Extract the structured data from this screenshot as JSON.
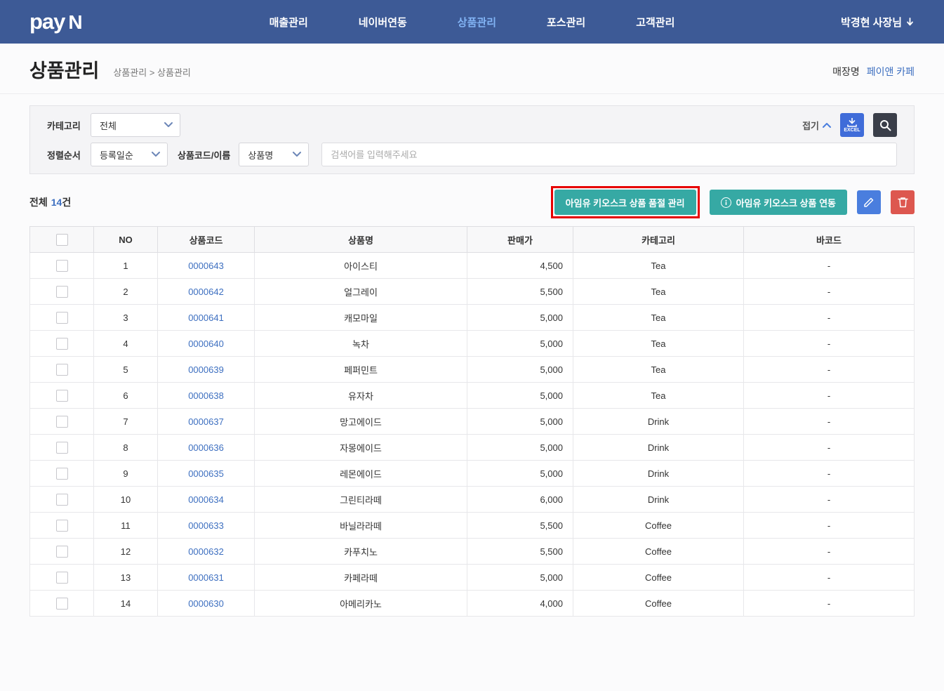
{
  "brand": {
    "logo_text_1": "pay",
    "logo_text_2": "N"
  },
  "nav": {
    "items": [
      {
        "label": "매출관리"
      },
      {
        "label": "네이버연동"
      },
      {
        "label": "상품관리"
      },
      {
        "label": "포스관리"
      },
      {
        "label": "고객관리"
      }
    ],
    "active_index": 2,
    "user": "박경현 사장님"
  },
  "page": {
    "title": "상품관리",
    "breadcrumb": "상품관리 > 상품관리",
    "store_label": "매장명",
    "store_name": "페이앤 카페"
  },
  "filters": {
    "category_label": "카테고리",
    "category_value": "전체",
    "sort_label": "정렬순서",
    "sort_value": "등록일순",
    "code_name_label": "상품코드/이름",
    "search_type_value": "상품명",
    "search_placeholder": "검색어를 입력해주세요",
    "collapse_label": "접기",
    "excel_label": "EXCEL"
  },
  "toolbar": {
    "total_label": "전체",
    "total_count": "14",
    "total_suffix": "건",
    "soldout_button_label": "아임유 키오스크 상품 품절 관리",
    "sync_button_label": "아임유 키오스크 상품 연동"
  },
  "table": {
    "headers": [
      "NO",
      "상품코드",
      "상품명",
      "판매가",
      "카테고리",
      "바코드"
    ],
    "rows": [
      {
        "no": "1",
        "code": "0000643",
        "name": "아이스티",
        "price": "4,500",
        "category": "Tea",
        "barcode": "-"
      },
      {
        "no": "2",
        "code": "0000642",
        "name": "얼그레이",
        "price": "5,500",
        "category": "Tea",
        "barcode": "-"
      },
      {
        "no": "3",
        "code": "0000641",
        "name": "캐모마일",
        "price": "5,000",
        "category": "Tea",
        "barcode": "-"
      },
      {
        "no": "4",
        "code": "0000640",
        "name": "녹차",
        "price": "5,000",
        "category": "Tea",
        "barcode": "-"
      },
      {
        "no": "5",
        "code": "0000639",
        "name": "페퍼민트",
        "price": "5,000",
        "category": "Tea",
        "barcode": "-"
      },
      {
        "no": "6",
        "code": "0000638",
        "name": "유자차",
        "price": "5,000",
        "category": "Tea",
        "barcode": "-"
      },
      {
        "no": "7",
        "code": "0000637",
        "name": "망고에이드",
        "price": "5,000",
        "category": "Drink",
        "barcode": "-"
      },
      {
        "no": "8",
        "code": "0000636",
        "name": "자몽에이드",
        "price": "5,000",
        "category": "Drink",
        "barcode": "-"
      },
      {
        "no": "9",
        "code": "0000635",
        "name": "레몬에이드",
        "price": "5,000",
        "category": "Drink",
        "barcode": "-"
      },
      {
        "no": "10",
        "code": "0000634",
        "name": "그린티라떼",
        "price": "6,000",
        "category": "Drink",
        "barcode": "-"
      },
      {
        "no": "11",
        "code": "0000633",
        "name": "바닐라라떼",
        "price": "5,500",
        "category": "Coffee",
        "barcode": "-"
      },
      {
        "no": "12",
        "code": "0000632",
        "name": "카푸치노",
        "price": "5,500",
        "category": "Coffee",
        "barcode": "-"
      },
      {
        "no": "13",
        "code": "0000631",
        "name": "카페라떼",
        "price": "5,000",
        "category": "Coffee",
        "barcode": "-"
      },
      {
        "no": "14",
        "code": "0000630",
        "name": "아메리카노",
        "price": "4,000",
        "category": "Coffee",
        "barcode": "-"
      }
    ]
  },
  "colors": {
    "navbar": "#3d5a96",
    "nav_active": "#82b4f5",
    "teal_button": "#36a9a4",
    "edit_button": "#4a7ede",
    "delete_button": "#dd574f",
    "excel_button": "#3f6cd9",
    "link_blue": "#3d6fc0",
    "highlight_border": "#e60000"
  }
}
